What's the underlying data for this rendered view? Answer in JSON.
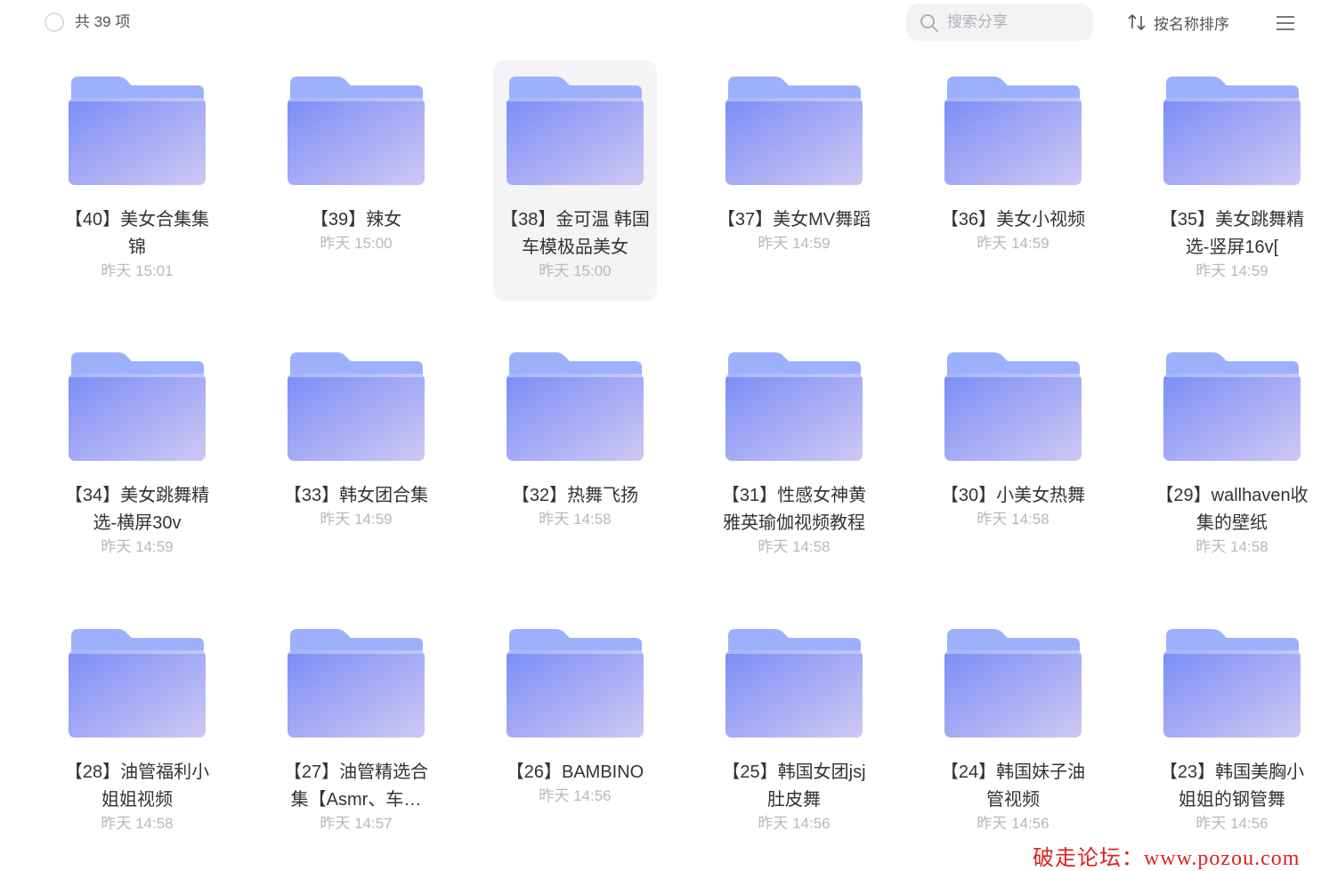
{
  "header": {
    "count_label": "共 39 项",
    "search_placeholder": "搜索分享",
    "sort_label": "按名称排序"
  },
  "colors": {
    "folder_back": "#9db0fb",
    "folder_front_start": "#7a8df7",
    "folder_front_end": "#cfc8f3",
    "selected_bg": "#f4f4f6",
    "watermark": "#e02020"
  },
  "icons": {
    "search": "search-icon",
    "sort": "sort-arrows-icon",
    "menu": "hamburger-menu-icon",
    "folder": "folder-icon"
  },
  "folders": [
    {
      "name": "【40】美女合集集锦",
      "time": "昨天 15:01"
    },
    {
      "name": "【39】辣女",
      "time": "昨天 15:00"
    },
    {
      "name": "【38】金可温 韩国车模极品美女",
      "time": "昨天 15:00",
      "selected": true
    },
    {
      "name": "【37】美女MV舞蹈",
      "time": "昨天 14:59"
    },
    {
      "name": "【36】美女小视频",
      "time": "昨天 14:59"
    },
    {
      "name": "【35】美女跳舞精选-竖屏16v[",
      "time": "昨天 14:59"
    },
    {
      "name": "【34】美女跳舞精选-横屏30v",
      "time": "昨天 14:59"
    },
    {
      "name": "【33】韩女团合集",
      "time": "昨天 14:59"
    },
    {
      "name": "【32】热舞飞扬",
      "time": "昨天 14:58"
    },
    {
      "name": "【31】性感女神黄雅英瑜伽视频教程",
      "time": "昨天 14:58"
    },
    {
      "name": "【30】小美女热舞",
      "time": "昨天 14:58"
    },
    {
      "name": "【29】wallhaven收集的壁纸",
      "time": "昨天 14:58"
    },
    {
      "name": "【28】油管福利小姐姐视频",
      "time": "昨天 14:58"
    },
    {
      "name": "【27】油管精选合集【Asmr、车…",
      "time": "昨天 14:57"
    },
    {
      "name": "【26】BAMBINO",
      "time": "昨天 14:56"
    },
    {
      "name": "【25】韩国女团jsj肚皮舞",
      "time": "昨天 14:56"
    },
    {
      "name": "【24】韩国妹子油管视频",
      "time": "昨天 14:56"
    },
    {
      "name": "【23】韩国美胸小姐姐的钢管舞",
      "time": "昨天 14:56"
    }
  ],
  "watermark": "破走论坛：www.pozou.com"
}
